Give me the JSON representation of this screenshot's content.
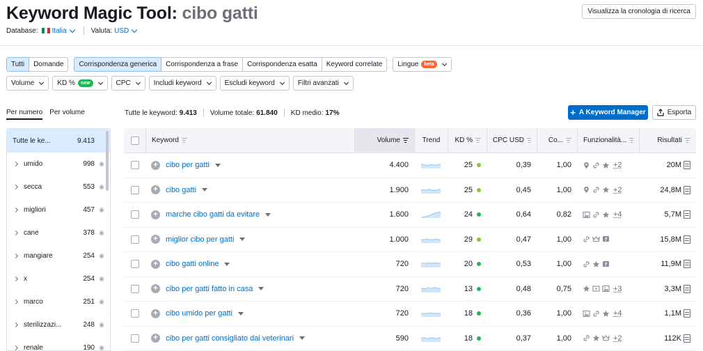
{
  "header": {
    "title_prefix": "Keyword Magic Tool:",
    "title_query": "cibo gatti",
    "history_button": "Visualizza la cronologia di ricerca",
    "database_label": "Database:",
    "database_value": "Italia",
    "currency_label": "Valuta:",
    "currency_value": "USD"
  },
  "filters": {
    "match_all": "Tutti",
    "match_questions": "Domande",
    "broad": "Corrispondenza generica",
    "phrase": "Corrispondenza a frase",
    "exact": "Corrispondenza esatta",
    "related": "Keyword correlate",
    "languages": "Lingue",
    "beta": "beta",
    "volume": "Volume",
    "kd": "KD %",
    "new": "new",
    "cpc": "CPC",
    "include": "Includi keyword",
    "exclude": "Escludi keyword",
    "advanced": "Filtri avanzati"
  },
  "tabs": {
    "by_number": "Per numero",
    "by_volume": "Per volume"
  },
  "stats": {
    "total_keywords_label": "Tutte le keyword:",
    "total_keywords": "9.413",
    "total_volume_label": "Volume totale:",
    "total_volume": "61.840",
    "kd_avg_label": "KD medio:",
    "kd_avg": "17%"
  },
  "actions": {
    "keyword_manager": "A Keyword Manager",
    "export": "Esporta"
  },
  "sidebar": {
    "items": [
      {
        "name": "Tutte le ke...",
        "count": "9.413"
      },
      {
        "name": "umido",
        "count": "998"
      },
      {
        "name": "secca",
        "count": "553"
      },
      {
        "name": "migliori",
        "count": "457"
      },
      {
        "name": "cane",
        "count": "378"
      },
      {
        "name": "mangiare",
        "count": "254"
      },
      {
        "name": "x",
        "count": "254"
      },
      {
        "name": "marco",
        "count": "251"
      },
      {
        "name": "sterilizzazi...",
        "count": "248"
      },
      {
        "name": "renale",
        "count": "190"
      }
    ]
  },
  "table": {
    "headers": {
      "keyword": "Keyword",
      "volume": "Volume",
      "trend": "Trend",
      "kd": "KD %",
      "cpc": "CPC USD",
      "competition": "Co...",
      "features": "Funzionalità...",
      "results": "Risultati"
    },
    "rows": [
      {
        "keyword": "cibo per gatti",
        "volume": "4.400",
        "kd": "25",
        "cpc": "0,39",
        "com": "1,00",
        "more": "+2",
        "results": "20M",
        "icons": [
          "pin",
          "link",
          "star"
        ],
        "trend": [
          6,
          6,
          5,
          5,
          5,
          5,
          6,
          5,
          5,
          5,
          6,
          6
        ]
      },
      {
        "keyword": "cibo gatti",
        "volume": "1.900",
        "kd": "25",
        "cpc": "0,45",
        "com": "1,00",
        "more": "+2",
        "results": "24,8M",
        "icons": [
          "pin",
          "link",
          "star"
        ],
        "trend": [
          5,
          6,
          5,
          5,
          6,
          6,
          5,
          5,
          5,
          5,
          6,
          6
        ]
      },
      {
        "keyword": "marche cibo gatti da evitare",
        "volume": "1.600",
        "kd": "24",
        "cpc": "0,64",
        "com": "0,82",
        "more": "+4",
        "results": "5,7M",
        "icons": [
          "image",
          "link",
          "star"
        ],
        "trend": [
          1,
          1,
          2,
          2,
          3,
          4,
          5,
          6,
          7,
          8,
          8,
          9
        ]
      },
      {
        "keyword": "miglior cibo per gatti",
        "volume": "1.000",
        "kd": "29",
        "cpc": "0,47",
        "com": "1,00",
        "more": "",
        "results": "15,8M",
        "icons": [
          "link",
          "crown",
          "faq"
        ],
        "trend": [
          5,
          5,
          5,
          6,
          5,
          5,
          5,
          5,
          6,
          5,
          5,
          5
        ]
      },
      {
        "keyword": "cibo gatti online",
        "volume": "720",
        "kd": "20",
        "cpc": "0,53",
        "com": "1,00",
        "more": "",
        "results": "11,9M",
        "icons": [
          "link",
          "star",
          "faq"
        ],
        "trend": [
          6,
          6,
          6,
          6,
          7,
          6,
          6,
          6,
          7,
          6,
          6,
          6
        ]
      },
      {
        "keyword": "cibo per gatti fatto in casa",
        "volume": "720",
        "kd": "13",
        "cpc": "0,48",
        "com": "0,75",
        "more": "+3",
        "results": "3,3M",
        "icons": [
          "star",
          "video",
          "image"
        ],
        "trend": [
          6,
          6,
          5,
          6,
          7,
          6,
          6,
          7,
          7,
          6,
          6,
          6
        ]
      },
      {
        "keyword": "cibo umido per gatti",
        "volume": "720",
        "kd": "18",
        "cpc": "0,36",
        "com": "1,00",
        "more": "+4",
        "results": "1,1M",
        "icons": [
          "image",
          "link",
          "star"
        ],
        "trend": [
          5,
          5,
          5,
          5,
          5,
          6,
          5,
          5,
          5,
          5,
          5,
          5
        ]
      },
      {
        "keyword": "cibo per gatti consigliato dai veterinari",
        "volume": "590",
        "kd": "18",
        "cpc": "0,37",
        "com": "1,00",
        "more": "+2",
        "results": "112K",
        "icons": [
          "link",
          "star",
          "crown"
        ],
        "trend": [
          6,
          6,
          6,
          5,
          5,
          6,
          6,
          6,
          5,
          5,
          6,
          6
        ]
      }
    ]
  },
  "colors": {
    "accent": "#006dca",
    "kd_green": "#1ab855",
    "kd_lime": "#85c92e",
    "active_bg": "#d9ecff",
    "beta_orange": "#ff642d"
  }
}
